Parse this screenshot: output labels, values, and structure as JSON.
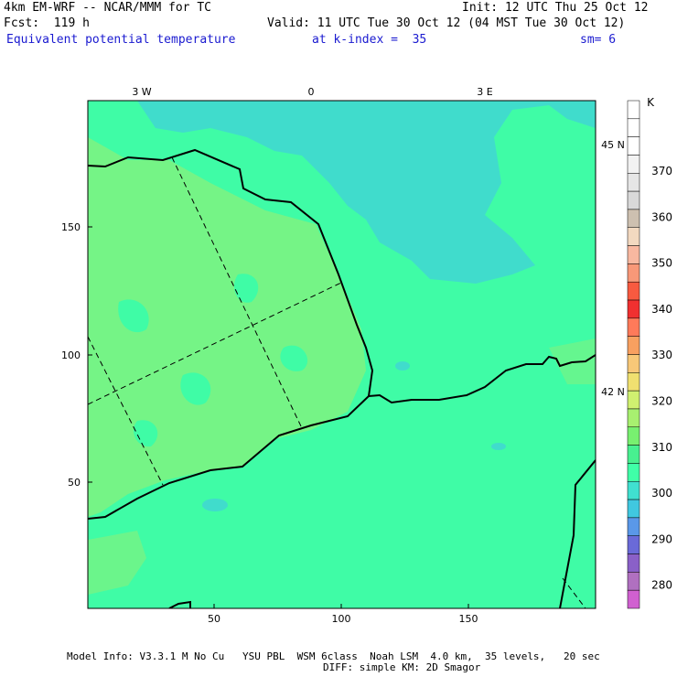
{
  "header": {
    "model": "4km EM-WRF -- NCAR/MMM for TC",
    "init": "Init: 12 UTC Thu 25 Oct 12",
    "fcst": "Fcst:  119 h",
    "valid": "Valid: 11 UTC Tue 30 Oct 12 (04 MST Tue 30 Oct 12)",
    "field": "Equivalent potential temperature",
    "level": "at k-index =  35",
    "smooth": "sm= 6"
  },
  "footer": {
    "line1": "Model Info: V3.3.1 M No Cu   YSU PBL  WSM 6class  Noah LSM  4.0 km,  35 levels,   20 sec",
    "line2": "DIFF: simple KM: 2D Smagor"
  },
  "map": {
    "top_labels": [
      "3 W",
      "0",
      "3 E"
    ],
    "right_labels": [
      "45 N",
      "42 N"
    ],
    "x_ticks": [
      "50",
      "100",
      "150"
    ],
    "y_ticks": [
      "150",
      "100",
      "50"
    ]
  },
  "colorbar": {
    "unit": "K",
    "labels": [
      "370",
      "360",
      "350",
      "340",
      "330",
      "320",
      "310",
      "300",
      "290",
      "280"
    ],
    "colors": [
      "#ffffff",
      "#ffffff",
      "#ffffff",
      "#f2f2f2",
      "#e6e6e6",
      "#d9d9d9",
      "#cdc0b0",
      "#f2d9c0",
      "#f8b8a0",
      "#f89878",
      "#f85a40",
      "#f03030",
      "#ff7a5a",
      "#f8a060",
      "#f8c878",
      "#f0e070",
      "#d0f070",
      "#a8f070",
      "#78f070",
      "#48f090",
      "#40ffa8",
      "#40e0d0",
      "#40c8e0",
      "#5a98e8",
      "#6a6ad8",
      "#8a60c8",
      "#b070c0",
      "#d060d0"
    ],
    "primary_colors": {
      "land": "#3ffca6",
      "valley": "#7ff280",
      "sea": "#40dccc"
    }
  }
}
